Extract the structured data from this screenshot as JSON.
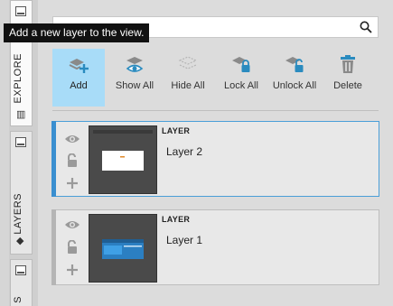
{
  "sidebar": {
    "tabs": [
      {
        "label": "EXPLORE",
        "active": true
      },
      {
        "label": "LAYERS",
        "active": false
      },
      {
        "label": "S",
        "active": false
      }
    ]
  },
  "search": {
    "value": "",
    "placeholder": ""
  },
  "tooltip": {
    "text": "Add a new layer to the view."
  },
  "toolbar": {
    "add_label": "Add",
    "show_all_label": "Show All",
    "hide_all_label": "Hide All",
    "lock_all_label": "Lock All",
    "unlock_all_label": "Unlock All",
    "delete_label": "Delete"
  },
  "layers": [
    {
      "kind": "LAYER",
      "name": "Layer 2",
      "selected": true
    },
    {
      "kind": "LAYER",
      "name": "Layer 1",
      "selected": false
    }
  ],
  "colors": {
    "accent": "#3a8fd0",
    "active_tool": "#a8dcf8",
    "icon_gray": "#8a8a8a",
    "icon_teal": "#2a8bbf"
  }
}
